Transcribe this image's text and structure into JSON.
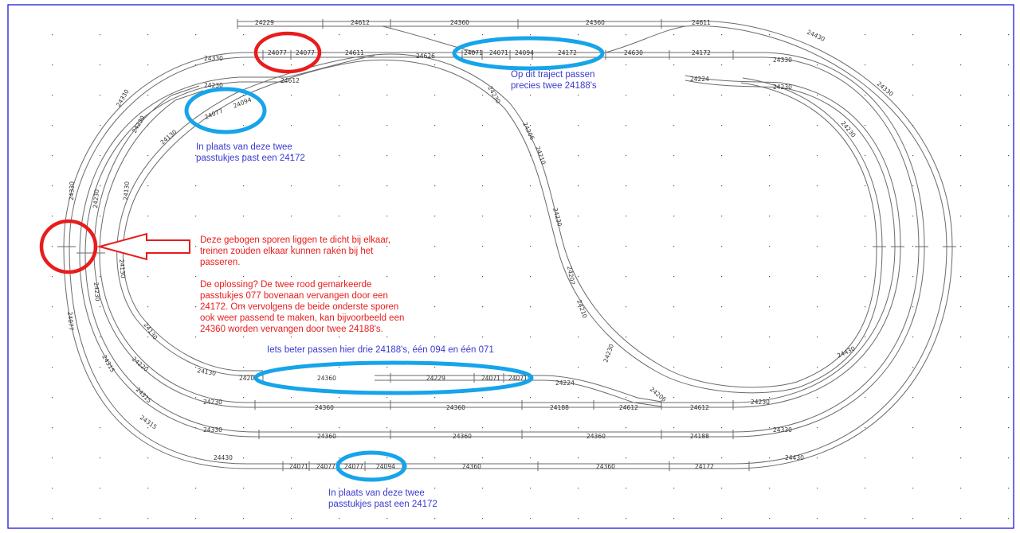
{
  "colors": {
    "frame": "#1a1ad8",
    "track": "#6a6a6a",
    "red_mark": "#e81c1c",
    "blue_mark": "#16a4ea",
    "blue_text": "#3a3ad0",
    "red_text": "#e81c1c"
  },
  "annotations": {
    "top_blue": [
      "Op dit traject passen",
      "precies twee 24188's"
    ],
    "left_blue": [
      "In plaats van deze twee",
      "passtukjes past een 24172"
    ],
    "red_note": [
      "Deze gebogen sporen liggen te dicht bij elkaar,",
      "treinen zouden elkaar kunnen raken bij het",
      "passeren."
    ],
    "red_solution": [
      "De oplossing? De twee rood gemarkeerde",
      "passtukjes 077 bovenaan vervangen door een",
      "24172. Om vervolgens de beide onderste sporen",
      "ook weer passend te maken, kan bijvoorbeeld een",
      "24360 worden vervangen door twee 24188's."
    ],
    "middle_blue": "Iets beter passen hier drie 24188's, één 094 en één 071",
    "bottom_blue": [
      "In plaats van deze twee",
      "passtukjes past een 24172"
    ]
  },
  "track_labels": {
    "top_line": [
      "24229",
      "24612",
      "24360",
      "24360",
      "24611"
    ],
    "row2_left": [
      "24330",
      "24077",
      "24077",
      "24611"
    ],
    "row2_mid": [
      "24626",
      "24071",
      "24071",
      "24094",
      "24172"
    ],
    "row2_right": [
      "24630",
      "24172",
      "24330"
    ],
    "inner_top_left": [
      "24230",
      "24612",
      "24077",
      "24094",
      "24130"
    ],
    "right_area": [
      "24224",
      "24230",
      "24430",
      "24330",
      "24230"
    ],
    "left_side": [
      "24330",
      "24230",
      "24230",
      "24130",
      "24330",
      "24230",
      "24130"
    ],
    "diagonal": [
      "24230",
      "24206",
      "24210",
      "24230",
      "24207",
      "24210",
      "24230",
      "24206"
    ],
    "middle_row": [
      "24206",
      "24360",
      "24229",
      "24071",
      "24071",
      "24224",
      "24130",
      "24430"
    ],
    "row_a": [
      "24230",
      "24360",
      "24360",
      "24188",
      "24612",
      "24612",
      "24230"
    ],
    "row_b": [
      "24330",
      "24360",
      "24360",
      "24360",
      "24188",
      "24330"
    ],
    "row_c": [
      "24430",
      "24071",
      "24077",
      "24077",
      "24094",
      "24360",
      "24360",
      "24172",
      "24430"
    ],
    "bottom_left": [
      "24077",
      "24315",
      "24315",
      "24315",
      "24220",
      "24130"
    ]
  }
}
